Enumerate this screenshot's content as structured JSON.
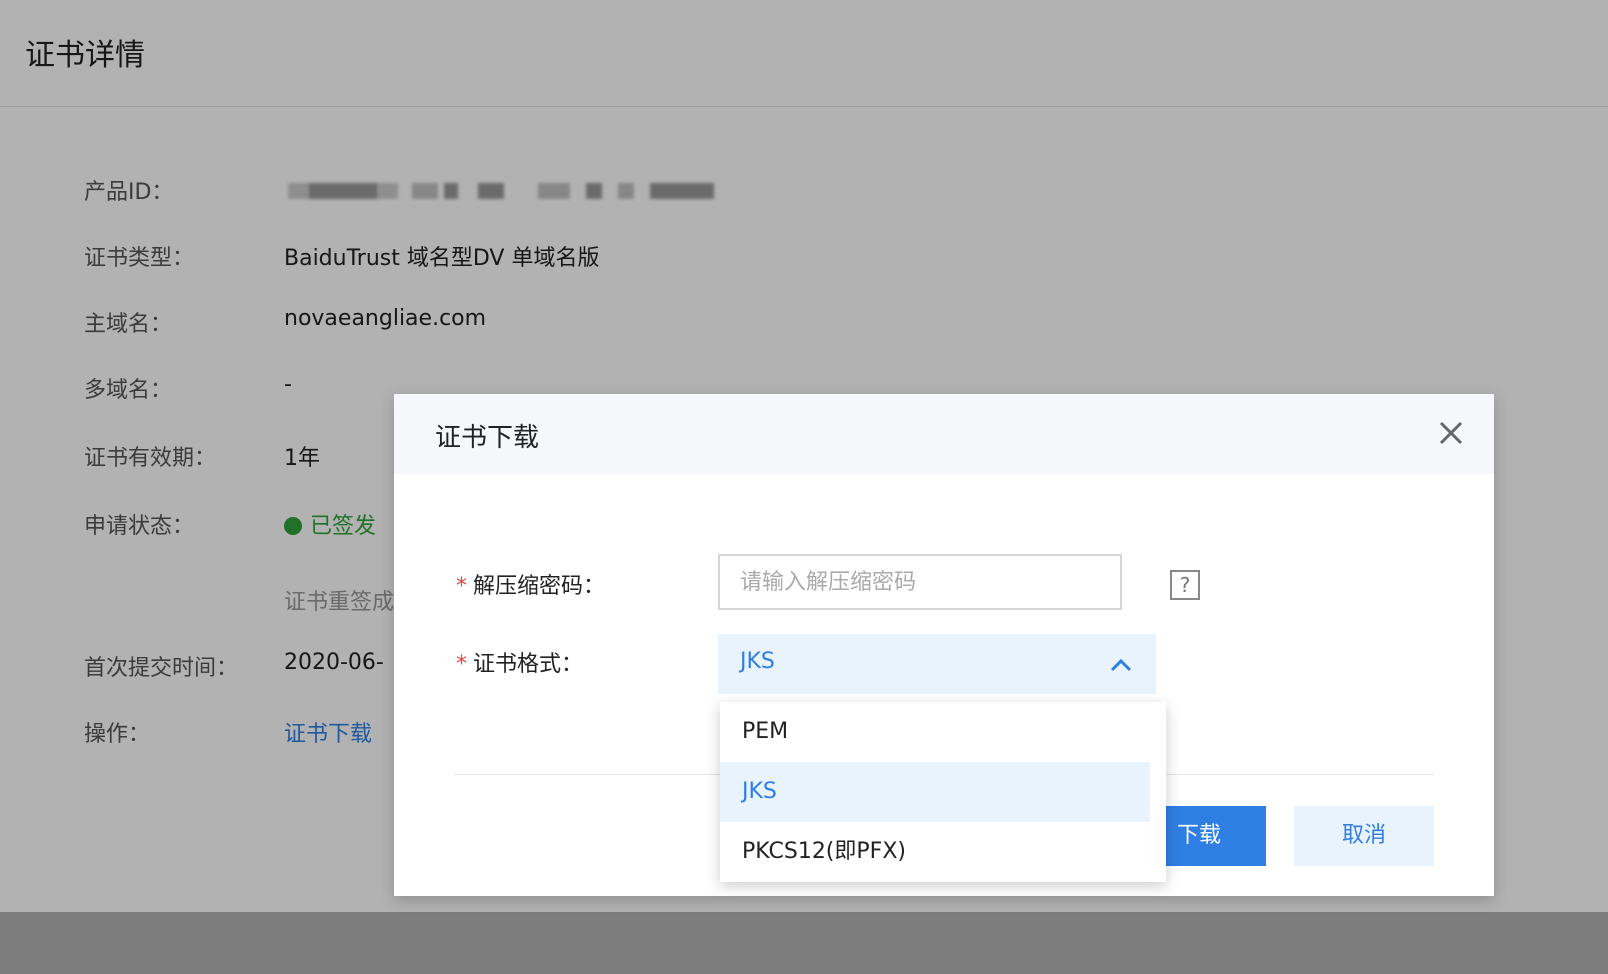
{
  "page": {
    "title": "证书详情",
    "fields": [
      {
        "label": "产品ID：",
        "value": ""
      },
      {
        "label": "证书类型：",
        "value": "BaiduTrust 域名型DV 单域名版"
      },
      {
        "label": "主域名：",
        "value": "novaeangliae.com"
      },
      {
        "label": "多域名：",
        "value": "-"
      },
      {
        "label": "证书有效期：",
        "value": "1年"
      },
      {
        "label": "申请状态：",
        "value": "已签发"
      },
      {
        "label": "",
        "value": "证书重签成"
      },
      {
        "label": "首次提交时间：",
        "value": "2020-06-"
      },
      {
        "label": "操作：",
        "value": "证书下载"
      }
    ]
  },
  "modal": {
    "title": "证书下载",
    "password_label": "解压缩密码：",
    "password_placeholder": "请输入解压缩密码",
    "help_symbol": "?",
    "format_label": "证书格式：",
    "format_selected": "JKS",
    "format_options": [
      "PEM",
      "JKS",
      "PKCS12(即PFX)"
    ],
    "download_label": "下载",
    "cancel_label": "取消",
    "required_mark": "*"
  },
  "colors": {
    "accent": "#2f7ee3",
    "success": "#2fa43b",
    "required": "#e54545"
  },
  "icons": {
    "close": "close-icon",
    "chevron": "chevron-up-icon",
    "help": "question-icon"
  }
}
